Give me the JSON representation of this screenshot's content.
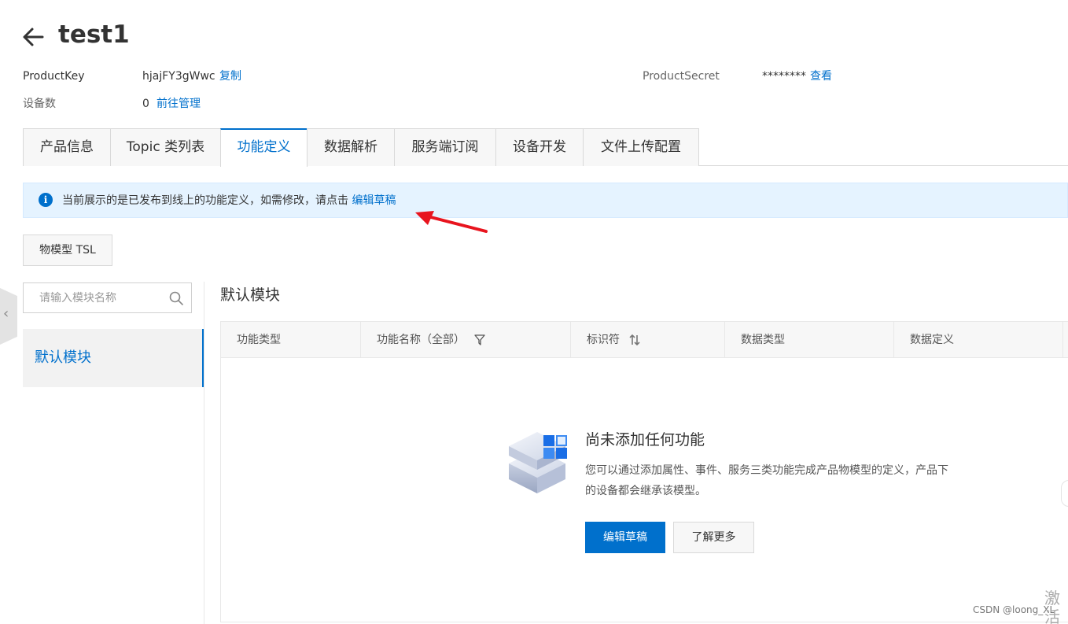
{
  "header": {
    "title": "test1"
  },
  "info": {
    "product_key_label": "ProductKey",
    "product_key_value": "hjajFY3gWwc",
    "copy_link": "复制",
    "product_secret_label": "ProductSecret",
    "product_secret_value": "********",
    "view_link": "查看",
    "device_count_label": "设备数",
    "device_count_value": "0",
    "manage_link": "前往管理"
  },
  "tabs": [
    {
      "label": "产品信息"
    },
    {
      "label": "Topic 类列表"
    },
    {
      "label": "功能定义",
      "active": true
    },
    {
      "label": "数据解析"
    },
    {
      "label": "服务端订阅"
    },
    {
      "label": "设备开发"
    },
    {
      "label": "文件上传配置"
    }
  ],
  "alert": {
    "text": "当前展示的是已发布到线上的功能定义，如需修改，请点击",
    "link": "编辑草稿"
  },
  "tsl_button": "物模型 TSL",
  "sidebar": {
    "search_placeholder": "请输入模块名称",
    "modules": [
      {
        "label": "默认模块"
      }
    ]
  },
  "main": {
    "section_title": "默认模块",
    "columns": [
      "功能类型",
      "功能名称（全部）",
      "标识符",
      "数据类型",
      "数据定义"
    ],
    "empty": {
      "title": "尚未添加任何功能",
      "desc_line1": "您可以通过添加属性、事件、服务三类功能完成产品物模型的定义，产品下",
      "desc_line2": "的设备都会继承该模型。",
      "primary_button": "编辑草稿",
      "secondary_button": "了解更多"
    }
  },
  "footer": {
    "watermark": "CSDN @loong_XL",
    "corner_text": "激活"
  },
  "colors": {
    "accent": "#0070cc",
    "alert_bg": "#e5f3ff",
    "annotation_arrow": "#e8141e"
  }
}
